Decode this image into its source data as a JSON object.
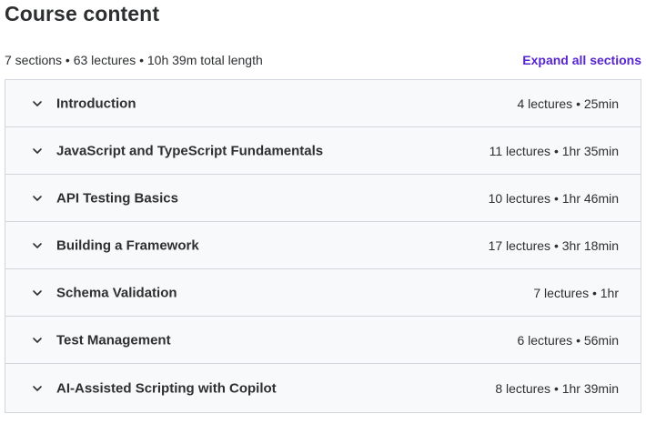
{
  "page": {
    "title": "Course content",
    "summary": "7 sections • 63 lectures • 10h 39m total length",
    "expand_label": "Expand all sections"
  },
  "colors": {
    "accent": "#5624d0",
    "text": "#2d2f31",
    "section_bg": "#f7f9fa",
    "border": "#d1d7dc"
  },
  "sections": [
    {
      "title": "Introduction",
      "meta": "4 lectures • 25min",
      "icon": "chevron-down-icon"
    },
    {
      "title": "JavaScript and TypeScript Fundamentals",
      "meta": "11 lectures • 1hr 35min",
      "icon": "chevron-down-icon"
    },
    {
      "title": "API Testing Basics",
      "meta": "10 lectures • 1hr 46min",
      "icon": "chevron-down-icon"
    },
    {
      "title": "Building a Framework",
      "meta": "17 lectures • 3hr 18min",
      "icon": "chevron-down-icon"
    },
    {
      "title": "Schema Validation",
      "meta": "7 lectures • 1hr",
      "icon": "chevron-down-icon"
    },
    {
      "title": "Test Management",
      "meta": "6 lectures • 56min",
      "icon": "chevron-down-icon"
    },
    {
      "title": "AI-Assisted Scripting with Copilot",
      "meta": "8 lectures • 1hr 39min",
      "icon": "chevron-down-icon"
    }
  ]
}
